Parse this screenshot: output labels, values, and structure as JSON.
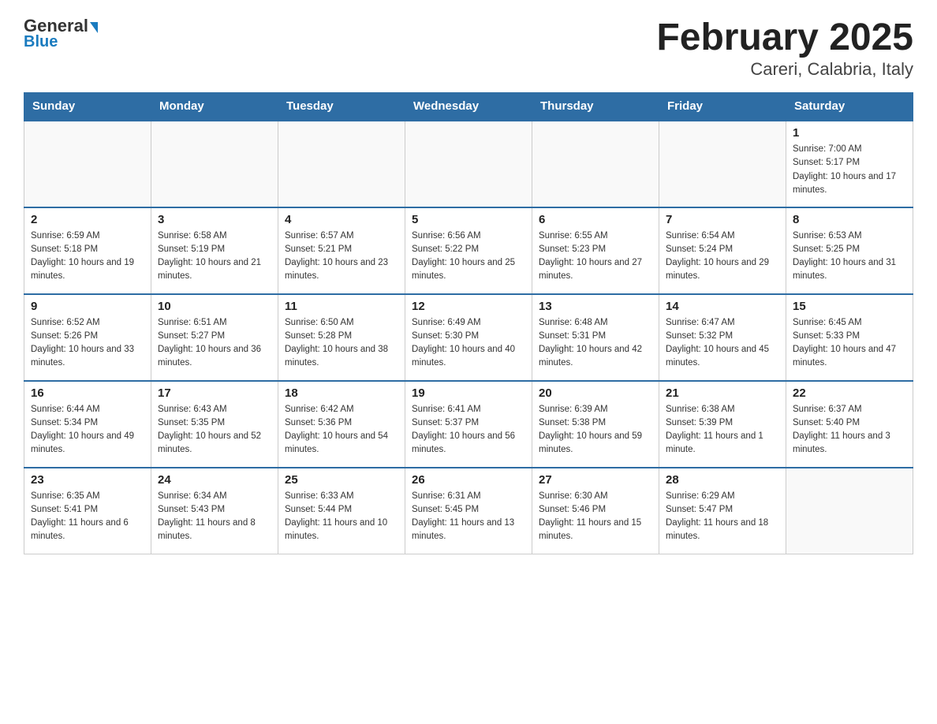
{
  "header": {
    "logo_main": "General",
    "logo_sub": "Blue",
    "title": "February 2025",
    "subtitle": "Careri, Calabria, Italy"
  },
  "days_of_week": [
    "Sunday",
    "Monday",
    "Tuesday",
    "Wednesday",
    "Thursday",
    "Friday",
    "Saturday"
  ],
  "weeks": [
    {
      "days": [
        {
          "date": "",
          "empty": true
        },
        {
          "date": "",
          "empty": true
        },
        {
          "date": "",
          "empty": true
        },
        {
          "date": "",
          "empty": true
        },
        {
          "date": "",
          "empty": true
        },
        {
          "date": "",
          "empty": true
        },
        {
          "date": "1",
          "sunrise": "7:00 AM",
          "sunset": "5:17 PM",
          "daylight": "10 hours and 17 minutes."
        }
      ]
    },
    {
      "days": [
        {
          "date": "2",
          "sunrise": "6:59 AM",
          "sunset": "5:18 PM",
          "daylight": "10 hours and 19 minutes."
        },
        {
          "date": "3",
          "sunrise": "6:58 AM",
          "sunset": "5:19 PM",
          "daylight": "10 hours and 21 minutes."
        },
        {
          "date": "4",
          "sunrise": "6:57 AM",
          "sunset": "5:21 PM",
          "daylight": "10 hours and 23 minutes."
        },
        {
          "date": "5",
          "sunrise": "6:56 AM",
          "sunset": "5:22 PM",
          "daylight": "10 hours and 25 minutes."
        },
        {
          "date": "6",
          "sunrise": "6:55 AM",
          "sunset": "5:23 PM",
          "daylight": "10 hours and 27 minutes."
        },
        {
          "date": "7",
          "sunrise": "6:54 AM",
          "sunset": "5:24 PM",
          "daylight": "10 hours and 29 minutes."
        },
        {
          "date": "8",
          "sunrise": "6:53 AM",
          "sunset": "5:25 PM",
          "daylight": "10 hours and 31 minutes."
        }
      ]
    },
    {
      "days": [
        {
          "date": "9",
          "sunrise": "6:52 AM",
          "sunset": "5:26 PM",
          "daylight": "10 hours and 33 minutes."
        },
        {
          "date": "10",
          "sunrise": "6:51 AM",
          "sunset": "5:27 PM",
          "daylight": "10 hours and 36 minutes."
        },
        {
          "date": "11",
          "sunrise": "6:50 AM",
          "sunset": "5:28 PM",
          "daylight": "10 hours and 38 minutes."
        },
        {
          "date": "12",
          "sunrise": "6:49 AM",
          "sunset": "5:30 PM",
          "daylight": "10 hours and 40 minutes."
        },
        {
          "date": "13",
          "sunrise": "6:48 AM",
          "sunset": "5:31 PM",
          "daylight": "10 hours and 42 minutes."
        },
        {
          "date": "14",
          "sunrise": "6:47 AM",
          "sunset": "5:32 PM",
          "daylight": "10 hours and 45 minutes."
        },
        {
          "date": "15",
          "sunrise": "6:45 AM",
          "sunset": "5:33 PM",
          "daylight": "10 hours and 47 minutes."
        }
      ]
    },
    {
      "days": [
        {
          "date": "16",
          "sunrise": "6:44 AM",
          "sunset": "5:34 PM",
          "daylight": "10 hours and 49 minutes."
        },
        {
          "date": "17",
          "sunrise": "6:43 AM",
          "sunset": "5:35 PM",
          "daylight": "10 hours and 52 minutes."
        },
        {
          "date": "18",
          "sunrise": "6:42 AM",
          "sunset": "5:36 PM",
          "daylight": "10 hours and 54 minutes."
        },
        {
          "date": "19",
          "sunrise": "6:41 AM",
          "sunset": "5:37 PM",
          "daylight": "10 hours and 56 minutes."
        },
        {
          "date": "20",
          "sunrise": "6:39 AM",
          "sunset": "5:38 PM",
          "daylight": "10 hours and 59 minutes."
        },
        {
          "date": "21",
          "sunrise": "6:38 AM",
          "sunset": "5:39 PM",
          "daylight": "11 hours and 1 minute."
        },
        {
          "date": "22",
          "sunrise": "6:37 AM",
          "sunset": "5:40 PM",
          "daylight": "11 hours and 3 minutes."
        }
      ]
    },
    {
      "days": [
        {
          "date": "23",
          "sunrise": "6:35 AM",
          "sunset": "5:41 PM",
          "daylight": "11 hours and 6 minutes."
        },
        {
          "date": "24",
          "sunrise": "6:34 AM",
          "sunset": "5:43 PM",
          "daylight": "11 hours and 8 minutes."
        },
        {
          "date": "25",
          "sunrise": "6:33 AM",
          "sunset": "5:44 PM",
          "daylight": "11 hours and 10 minutes."
        },
        {
          "date": "26",
          "sunrise": "6:31 AM",
          "sunset": "5:45 PM",
          "daylight": "11 hours and 13 minutes."
        },
        {
          "date": "27",
          "sunrise": "6:30 AM",
          "sunset": "5:46 PM",
          "daylight": "11 hours and 15 minutes."
        },
        {
          "date": "28",
          "sunrise": "6:29 AM",
          "sunset": "5:47 PM",
          "daylight": "11 hours and 18 minutes."
        },
        {
          "date": "",
          "empty": true
        }
      ]
    }
  ],
  "labels": {
    "sunrise": "Sunrise:",
    "sunset": "Sunset:",
    "daylight": "Daylight:"
  }
}
